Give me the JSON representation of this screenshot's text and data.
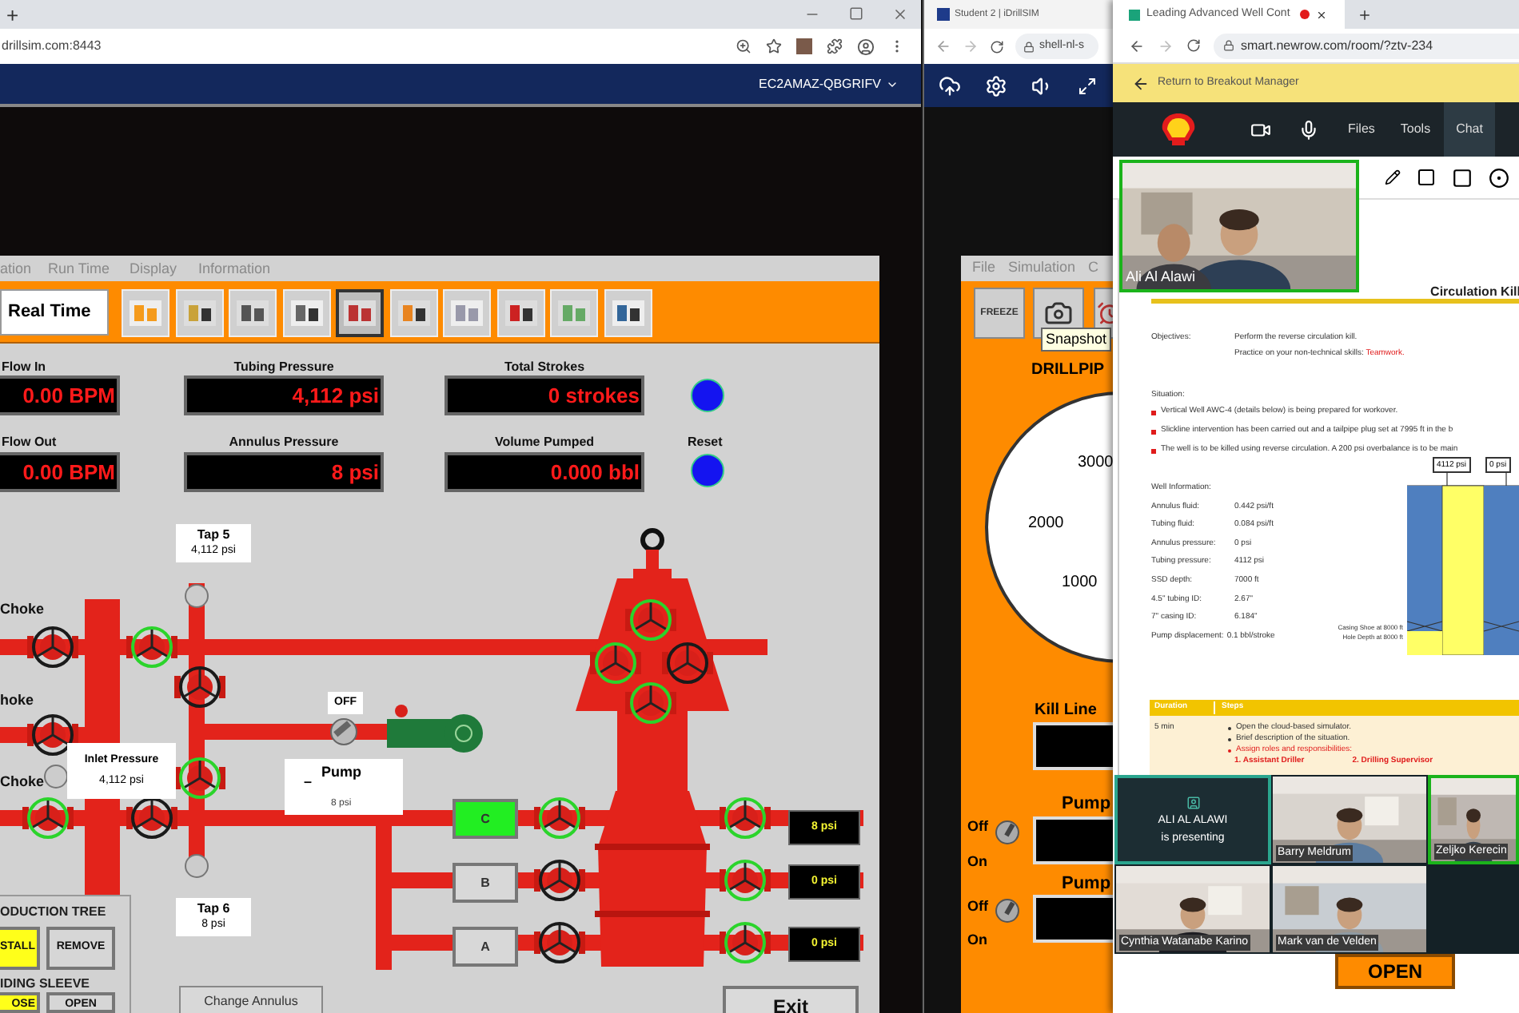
{
  "left_browser": {
    "new_tab": "+",
    "url": "drillsim.com:8443",
    "machine": "EC2AMAZ-QBGRIFV"
  },
  "simulator": {
    "menu": [
      "ation",
      "Run Time",
      "Display",
      "Information"
    ],
    "mode_button": "Real Time",
    "tool_buttons": [
      {
        "selected": false
      },
      {
        "selected": false
      },
      {
        "selected": false
      },
      {
        "selected": false
      },
      {
        "selected": true
      },
      {
        "selected": false
      },
      {
        "selected": false
      },
      {
        "selected": false
      },
      {
        "selected": false
      },
      {
        "selected": false
      }
    ],
    "displays": [
      {
        "label": "Flow In",
        "value": "0.00 BPM"
      },
      {
        "label": "Tubing Pressure",
        "value": "4,112 psi"
      },
      {
        "label": "Total Strokes",
        "value": "0 strokes"
      },
      {
        "label": "Flow Out",
        "value": "0.00 BPM"
      },
      {
        "label": "Annulus Pressure",
        "value": "8 psi"
      },
      {
        "label": "Volume Pumped",
        "value": "0.000 bbl"
      }
    ],
    "reset_label": "Reset",
    "taps": [
      {
        "name": "Tap 5",
        "value": "4,112 psi"
      },
      {
        "name": "Tap 6",
        "value": "8 psi"
      }
    ],
    "choke_labels": [
      "Choke",
      "hoke",
      "Choke"
    ],
    "inlet": {
      "label": "Inlet Pressure",
      "value": "4,112 psi"
    },
    "pump_switch": "OFF",
    "pump": {
      "label": "Pump",
      "dash": "–",
      "value": "8 psi"
    },
    "line_buttons": [
      {
        "label": "C",
        "on": true,
        "reading": "8 psi"
      },
      {
        "label": "B",
        "on": false,
        "reading": "0 psi"
      },
      {
        "label": "A",
        "on": false,
        "reading": "0 psi"
      }
    ],
    "production_tree": {
      "title": "ODUCTION TREE",
      "buttons": [
        {
          "label": "STALL",
          "highlighted": true
        },
        {
          "label": "REMOVE",
          "highlighted": false
        }
      ]
    },
    "sliding_sleeve": {
      "title": "IDING SLEEVE",
      "buttons": [
        {
          "label": "OSE",
          "highlighted": true
        },
        {
          "label": "OPEN",
          "highlighted": false
        }
      ]
    },
    "change_button": "Change Annulus",
    "exit_button": "Exit"
  },
  "student_browser": {
    "tab": "Student 2 | iDrillSIM",
    "url": "shell-nl-s",
    "sim": {
      "menu": [
        "File",
        "Simulation",
        "C"
      ],
      "freeze": "FREEZE",
      "tooltip": "Snapshot",
      "gauge_title": "DRILLPIP",
      "gauge_labels": [
        "3000",
        "2000",
        "1000"
      ],
      "kill_line": "Kill Line",
      "pumps": [
        {
          "label": "Pump",
          "off": "Off",
          "on": "On",
          "switch_on": false
        },
        {
          "label": "Pump",
          "off": "Off",
          "on": "On",
          "switch_on": false
        }
      ],
      "open_button": "OPEN"
    }
  },
  "meeting_browser": {
    "tab": "Leading Advanced Well Cont",
    "url": "smart.newrow.com/room/?ztv-234",
    "back": "Return to Breakout Manager",
    "nav": [
      {
        "label": "Files",
        "selected": false
      },
      {
        "label": "Tools",
        "selected": false
      },
      {
        "label": "Chat",
        "selected": true
      }
    ],
    "main_video": {
      "name": "Ali Al Alawi",
      "speaking": true
    },
    "document": {
      "heading": "Circulation Kill",
      "objectives": {
        "label": "Objectives:",
        "lines": [
          {
            "text": "Perform the reverse circulation kill."
          },
          {
            "text": "Practice on your non-technical skills:",
            "highlight": "Teamwork."
          }
        ]
      },
      "situation": {
        "label": "Situation:",
        "bullets": [
          "Vertical Well AWC-4 (details below) is being prepared for workover.",
          "Slickline intervention has been carried out and a tailpipe plug set at 7995 ft in the b",
          "The well is to be killed using reverse circulation. A 200 psi overbalance is to be main"
        ]
      },
      "well_info": {
        "title": "Well Information:",
        "rows": [
          {
            "label": "Annulus fluid:",
            "value": "0.442 psi/ft"
          },
          {
            "label": "Tubing fluid:",
            "value": "0.084 psi/ft"
          },
          {
            "label": "Annulus pressure:",
            "value": "0 psi"
          },
          {
            "label": "Tubing pressure:",
            "value": "4112 psi"
          },
          {
            "label": "SSD depth:",
            "value": "7000 ft"
          },
          {
            "label": "4.5\" tubing ID:",
            "value": "2.67\""
          },
          {
            "label": "7\" casing ID:",
            "value": "6.184\""
          },
          {
            "label": "Pump displacement:",
            "value": "0.1 bbl/stroke"
          }
        ]
      },
      "well_diagram": {
        "gauges": [
          "4112 psi",
          "0 psi"
        ],
        "notes": [
          "Casing Shoe at 8000 ft",
          "Hole Depth at 8000 ft"
        ]
      },
      "table": {
        "headers": [
          "Duration",
          "Steps"
        ],
        "duration": "5 min",
        "steps": [
          {
            "text": "Open the cloud-based simulator.",
            "emphasis": false
          },
          {
            "text": "Brief description of the situation.",
            "emphasis": false
          },
          {
            "text": "Assign roles and responsibilities:",
            "emphasis": true
          }
        ],
        "roles": [
          "1. Assistant Driller",
          "2. Drilling Supervisor"
        ]
      }
    },
    "presenter": {
      "name": "ALI AL ALAWI",
      "status": "is presenting"
    },
    "participants": [
      {
        "name": "Barry Meldrum",
        "speaking": false
      },
      {
        "name": "Zeljko Kerecin",
        "speaking": true
      },
      {
        "name": "Cynthia Watanabe Karino",
        "speaking": false
      },
      {
        "name": "Mark van de Velden",
        "speaking": false
      }
    ]
  }
}
